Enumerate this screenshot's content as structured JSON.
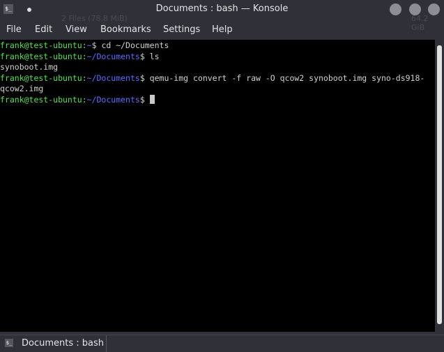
{
  "window": {
    "title": "Documents : bash — Konsole",
    "app_icon": "$_",
    "background_ghost": [
      "2 Files (78.8 MiB)",
      "64.2 GiB"
    ]
  },
  "menu": [
    "File",
    "Edit",
    "View",
    "Bookmarks",
    "Settings",
    "Help"
  ],
  "terminal": {
    "lines": [
      {
        "user": "frank@test-ubuntu",
        "path": "~",
        "cmd": " cd ~/Documents"
      },
      {
        "user": "frank@test-ubuntu",
        "path": "~/Documents",
        "cmd": " ls"
      },
      {
        "output": "synoboot.img"
      },
      {
        "user": "frank@test-ubuntu",
        "path": "~/Documents",
        "cmd": " qemu-img convert -f raw -O qcow2 synoboot.img syno-ds918-"
      },
      {
        "output": "qcow2.img"
      },
      {
        "user": "frank@test-ubuntu",
        "path": "~/Documents",
        "cmd": " ",
        "cursor": true
      }
    ]
  },
  "tabs": [
    {
      "label": "Documents : bash",
      "icon": "$_"
    }
  ]
}
